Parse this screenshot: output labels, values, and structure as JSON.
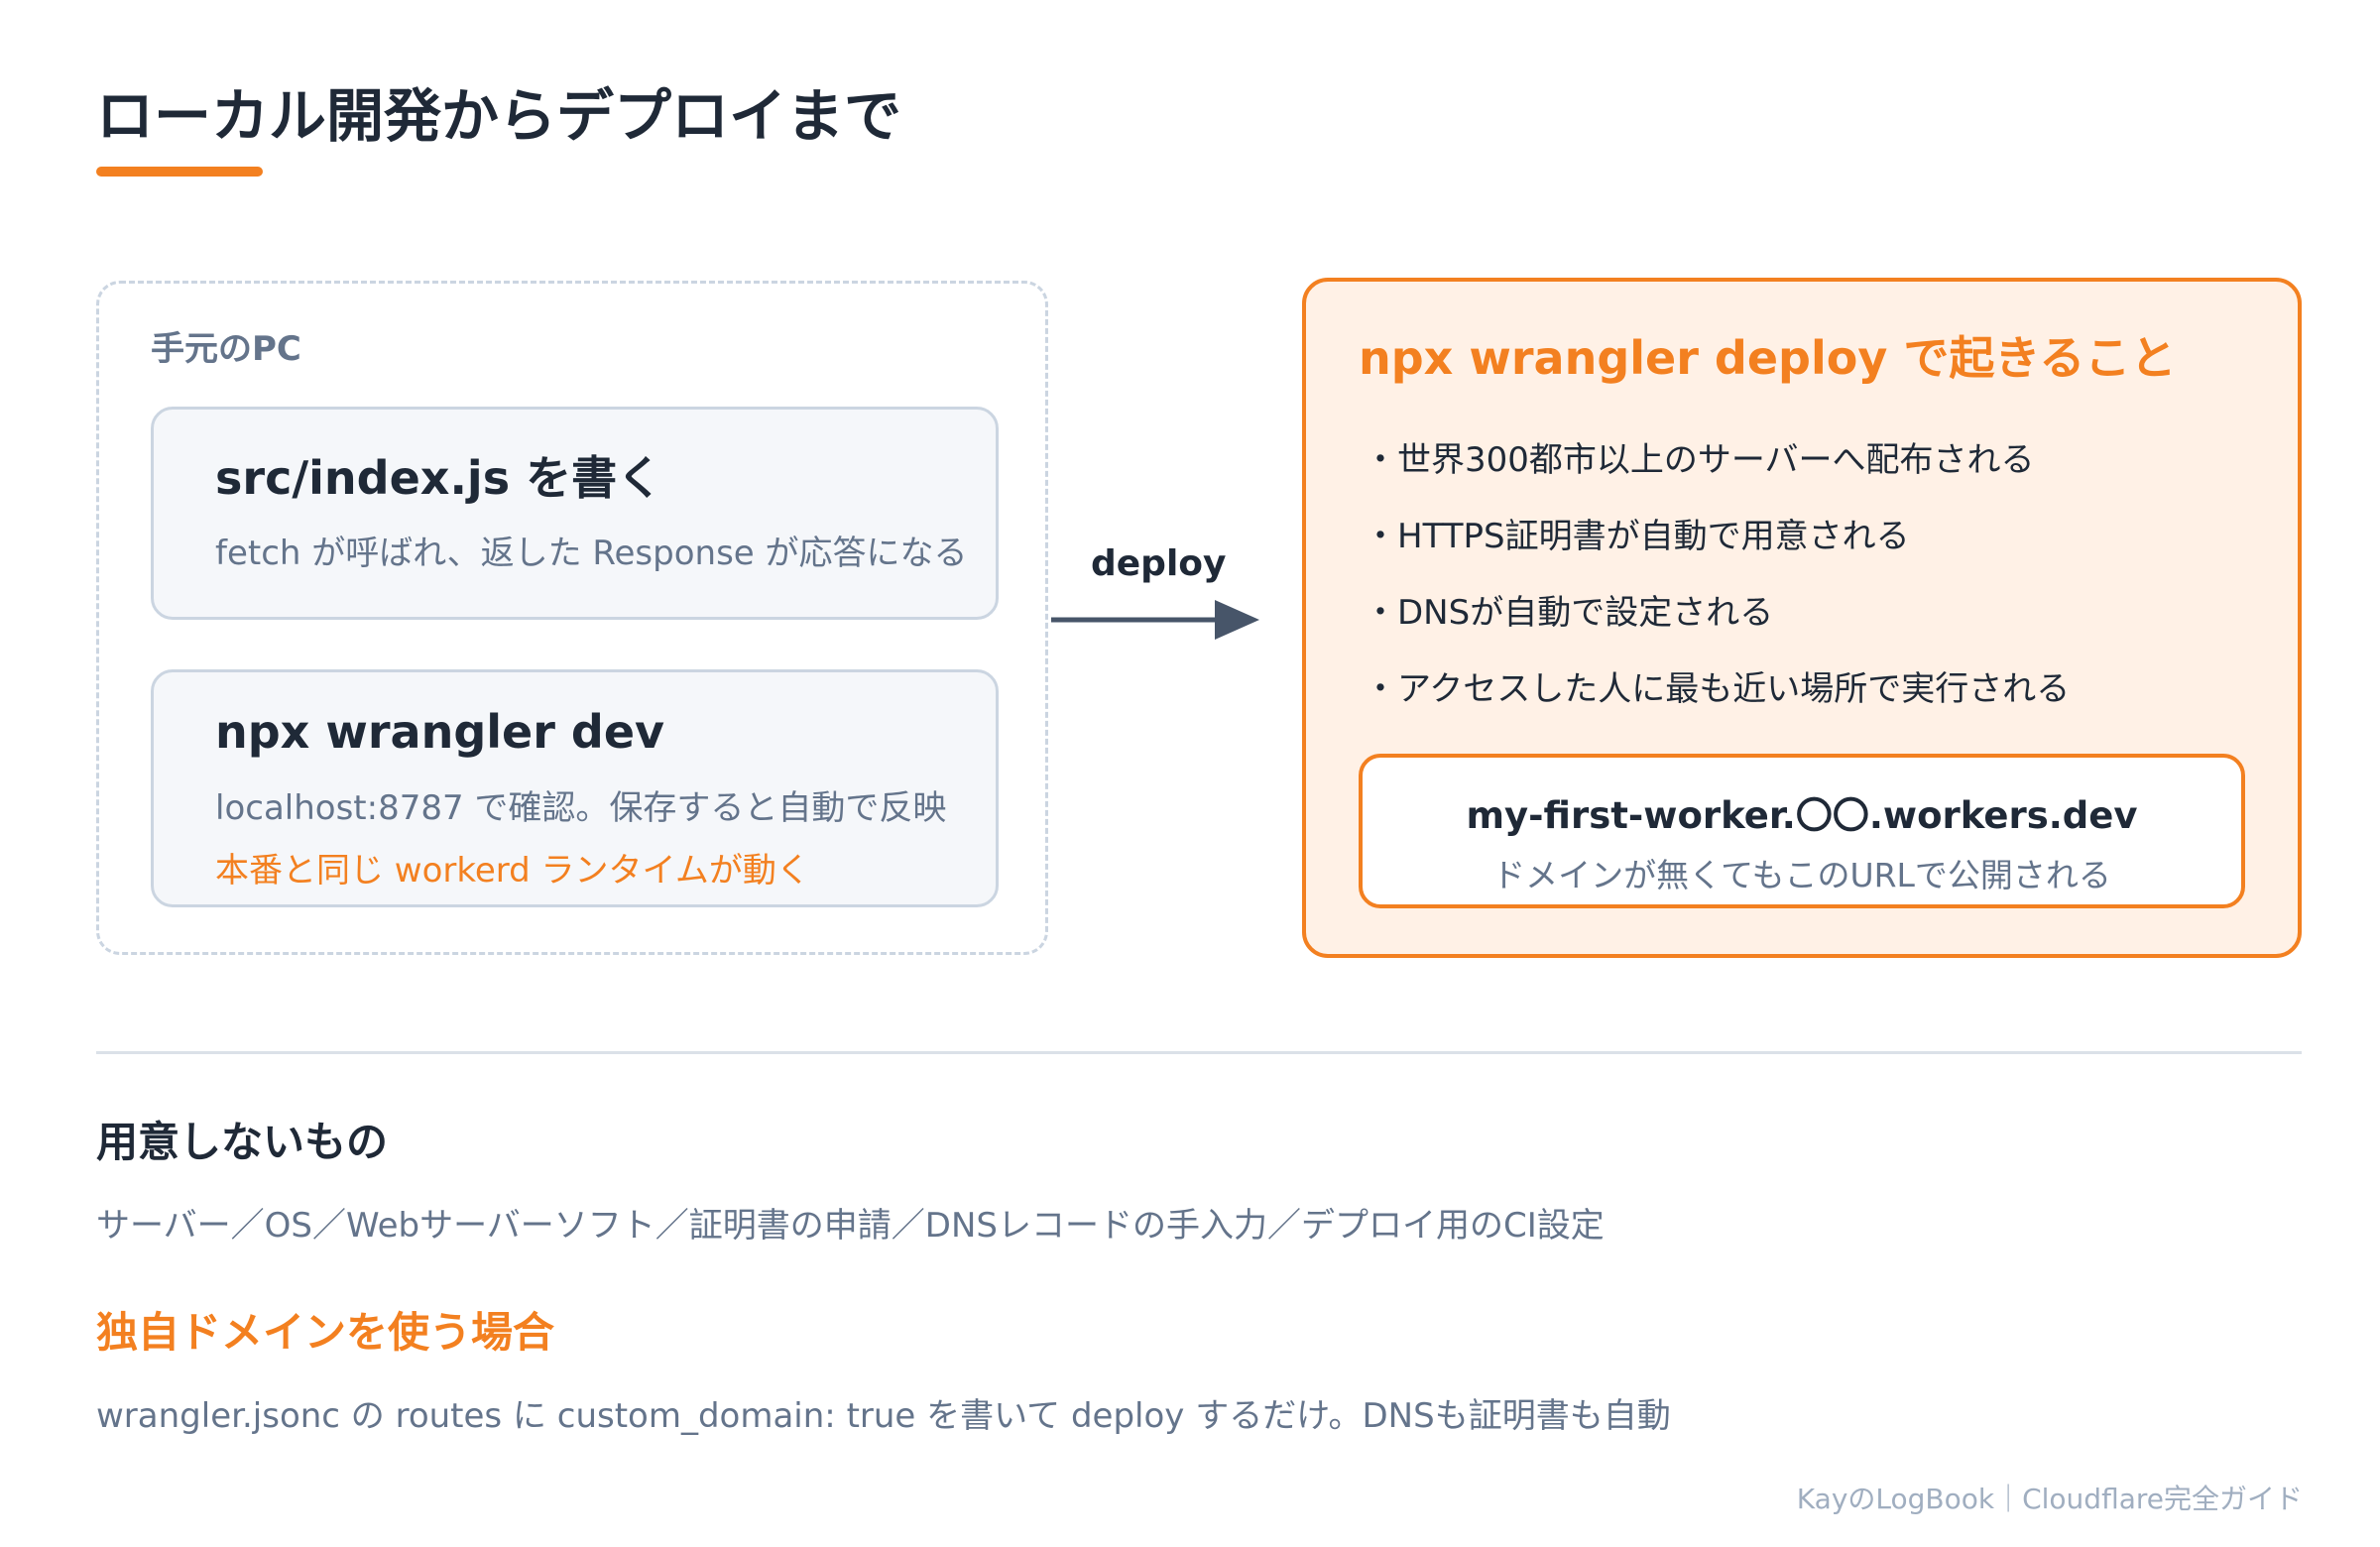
{
  "title": "ローカル開発からデプロイまで",
  "local": {
    "label": "手元のPC",
    "cards": [
      {
        "title": "src/index.js を書く",
        "subtitle": "fetch が呼ばれ、返した Response が応答になる"
      },
      {
        "title": "npx wrangler dev",
        "subtitle": "localhost:8787 で確認。保存すると自動で反映",
        "note": "本番と同じ workerd ランタイムが動く"
      }
    ]
  },
  "arrow": {
    "label": "deploy"
  },
  "deploy": {
    "title": "npx wrangler deploy で起きること",
    "items": [
      "・世界300都市以上のサーバーへ配布される",
      "・HTTPS証明書が自動で用意される",
      "・DNSが自動で設定される",
      "・アクセスした人に最も近い場所で実行される"
    ],
    "url": {
      "main": "my-first-worker.〇〇.workers.dev",
      "sub": "ドメインが無くてもこのURLで公開される"
    }
  },
  "not_needed": {
    "heading": "用意しないもの",
    "text": "サーバー／OS／Webサーバーソフト／証明書の申請／DNSレコードの手入力／デプロイ用のCI設定"
  },
  "custom_domain": {
    "heading": "独自ドメインを使う場合",
    "text": "wrangler.jsonc の routes に custom_domain: true を書いて deploy するだけ。DNSも証明書も自動"
  },
  "footer": "KayのLogBook｜Cloudflare完全ガイド",
  "colors": {
    "accent": "#f38020",
    "text": "#1f2937",
    "muted": "#64748b",
    "deploy_bg": "#fff1e6"
  }
}
